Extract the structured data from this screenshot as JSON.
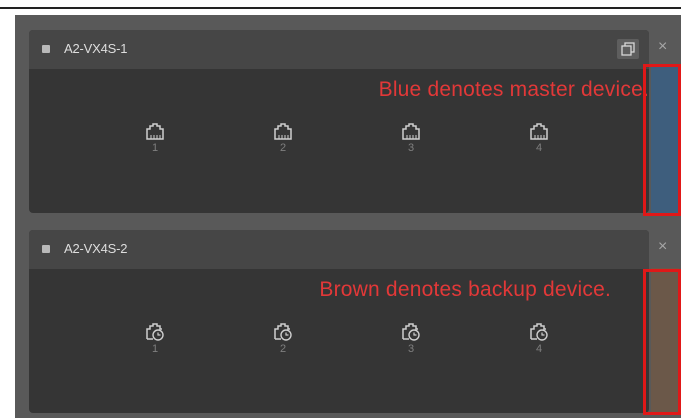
{
  "devices": [
    {
      "name": "A2-VX4S-1",
      "note": "Blue denotes master device.",
      "role_color": "#3e5e7d",
      "ports": [
        "1",
        "2",
        "3",
        "4"
      ],
      "port_icon": "ethernet-port-icon"
    },
    {
      "name": "A2-VX4S-2",
      "note": "Brown denotes backup device.",
      "role_color": "#6b5849",
      "ports": [
        "1",
        "2",
        "3",
        "4"
      ],
      "port_icon": "ethernet-port-backup-icon"
    }
  ],
  "close_glyph": "×",
  "colors": {
    "note": "#e23838",
    "highlight_box": "#e01818",
    "panel": "#353535",
    "panel_header": "#464646"
  }
}
